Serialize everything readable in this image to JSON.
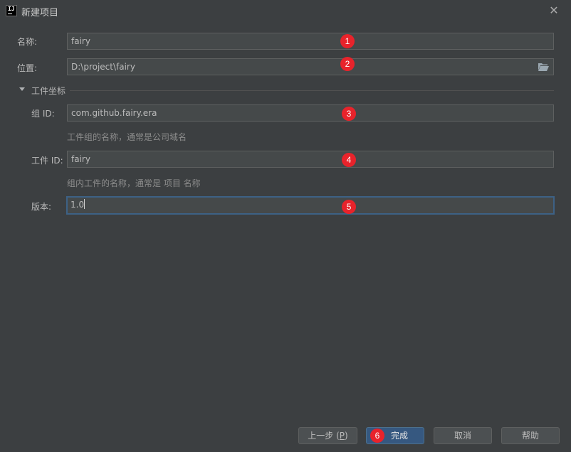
{
  "window": {
    "title": "新建项目",
    "app_icon_text": "IJ",
    "close_glyph": "✕"
  },
  "form": {
    "name": {
      "label": "名称:",
      "value": "fairy"
    },
    "location": {
      "label": "位置:",
      "value": "D:\\project\\fairy"
    },
    "section": {
      "title": "工件坐标"
    },
    "group_id": {
      "label": "组 ID:",
      "value": "com.github.fairy.era",
      "hint": "工件组的名称，通常是公司域名"
    },
    "artifact_id": {
      "label": "工件 ID:",
      "value": "fairy",
      "hint": "组内工件的名称，通常是 项目 名称"
    },
    "version": {
      "label": "版本:",
      "value": "1.0"
    }
  },
  "badges": [
    "1",
    "2",
    "3",
    "4",
    "5",
    "6"
  ],
  "buttons": {
    "previous": {
      "label": "上一步 (",
      "mnemonic": "P",
      "suffix": ")"
    },
    "finish": {
      "label": "完成"
    },
    "cancel": {
      "label": "取消"
    },
    "help": {
      "label": "帮助"
    }
  },
  "colors": {
    "background": "#3c3f41",
    "field": "#45494a",
    "badge": "#e8232b",
    "default_button": "#365880",
    "focus_border": "#3d6185"
  },
  "icons": {
    "app": "intellij-icon",
    "close": "close-icon",
    "folder": "folder-open-icon",
    "toggle": "triangle-down-icon"
  }
}
